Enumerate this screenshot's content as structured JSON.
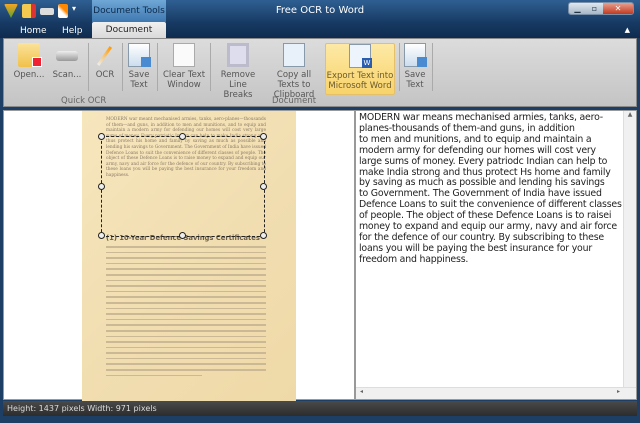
{
  "window": {
    "title": "Free OCR to Word",
    "contextual_tab": "Document Tools"
  },
  "tabs": [
    {
      "label": "Home"
    },
    {
      "label": "Help"
    },
    {
      "label": "Document"
    }
  ],
  "ribbon": {
    "buttons": [
      {
        "label": "Open..."
      },
      {
        "label": "Scan..."
      },
      {
        "label": "OCR"
      },
      {
        "label": "Save Text"
      },
      {
        "label": "Clear Text Window"
      },
      {
        "label": "Remove Line Breaks"
      },
      {
        "label": "Copy all Texts to Clipboard"
      },
      {
        "label": "Export Text into Microsoft Word"
      },
      {
        "label": "Save Text"
      }
    ],
    "groups": {
      "quick_ocr": "Quick OCR",
      "document": "Document"
    }
  },
  "scan": {
    "paragraph": "MODERN war meant mechanised armies, tanks, aero-planes—thousands of them—and guns, in addition to men and munitions, and to equip and maintain a modern army for defending our homes will cost very large sums of money. Every patriotic Indian can help to make India strong and thus protect his home and family by saving as much as possible and lending his savings to Government. The Government of India have issued Defence Loans to suit the convenience of different classes of people. The object of these Defence Loans is to raise money to expand and equip our army, navy and air force for the defence of our country. By subscribing to these loans you will be paying the best insurance for your freedom and happiness.",
    "heading": "(1) 10-Year Defence Savings Certificates"
  },
  "ocr_text": "MODERN war means mechanised armies, tanks, aero-\nplanes-thousands of them-and guns, in addition\nto men and munitions, and to equip and maintain a\nmodern army for defending our homes will cost very\nlarge sums of money. Every patriodc Indian can help to\nmake India strong and thus protect Hs home and family\nby saving as much as possible and lending his savings\nto Government. The Government of India have issued\nDefence Loans to suit the convenience of different classes\nof people. The object of these Defence Loans is to raisei\nmoney to expand and equip our army, navy and air force\nfor the defence of our country. By subscribing to these\nloans you will be paying the best insurance for your\nfreedom and happiness.",
  "status": "Height: 1437 pixels  Width: 971 pixels"
}
